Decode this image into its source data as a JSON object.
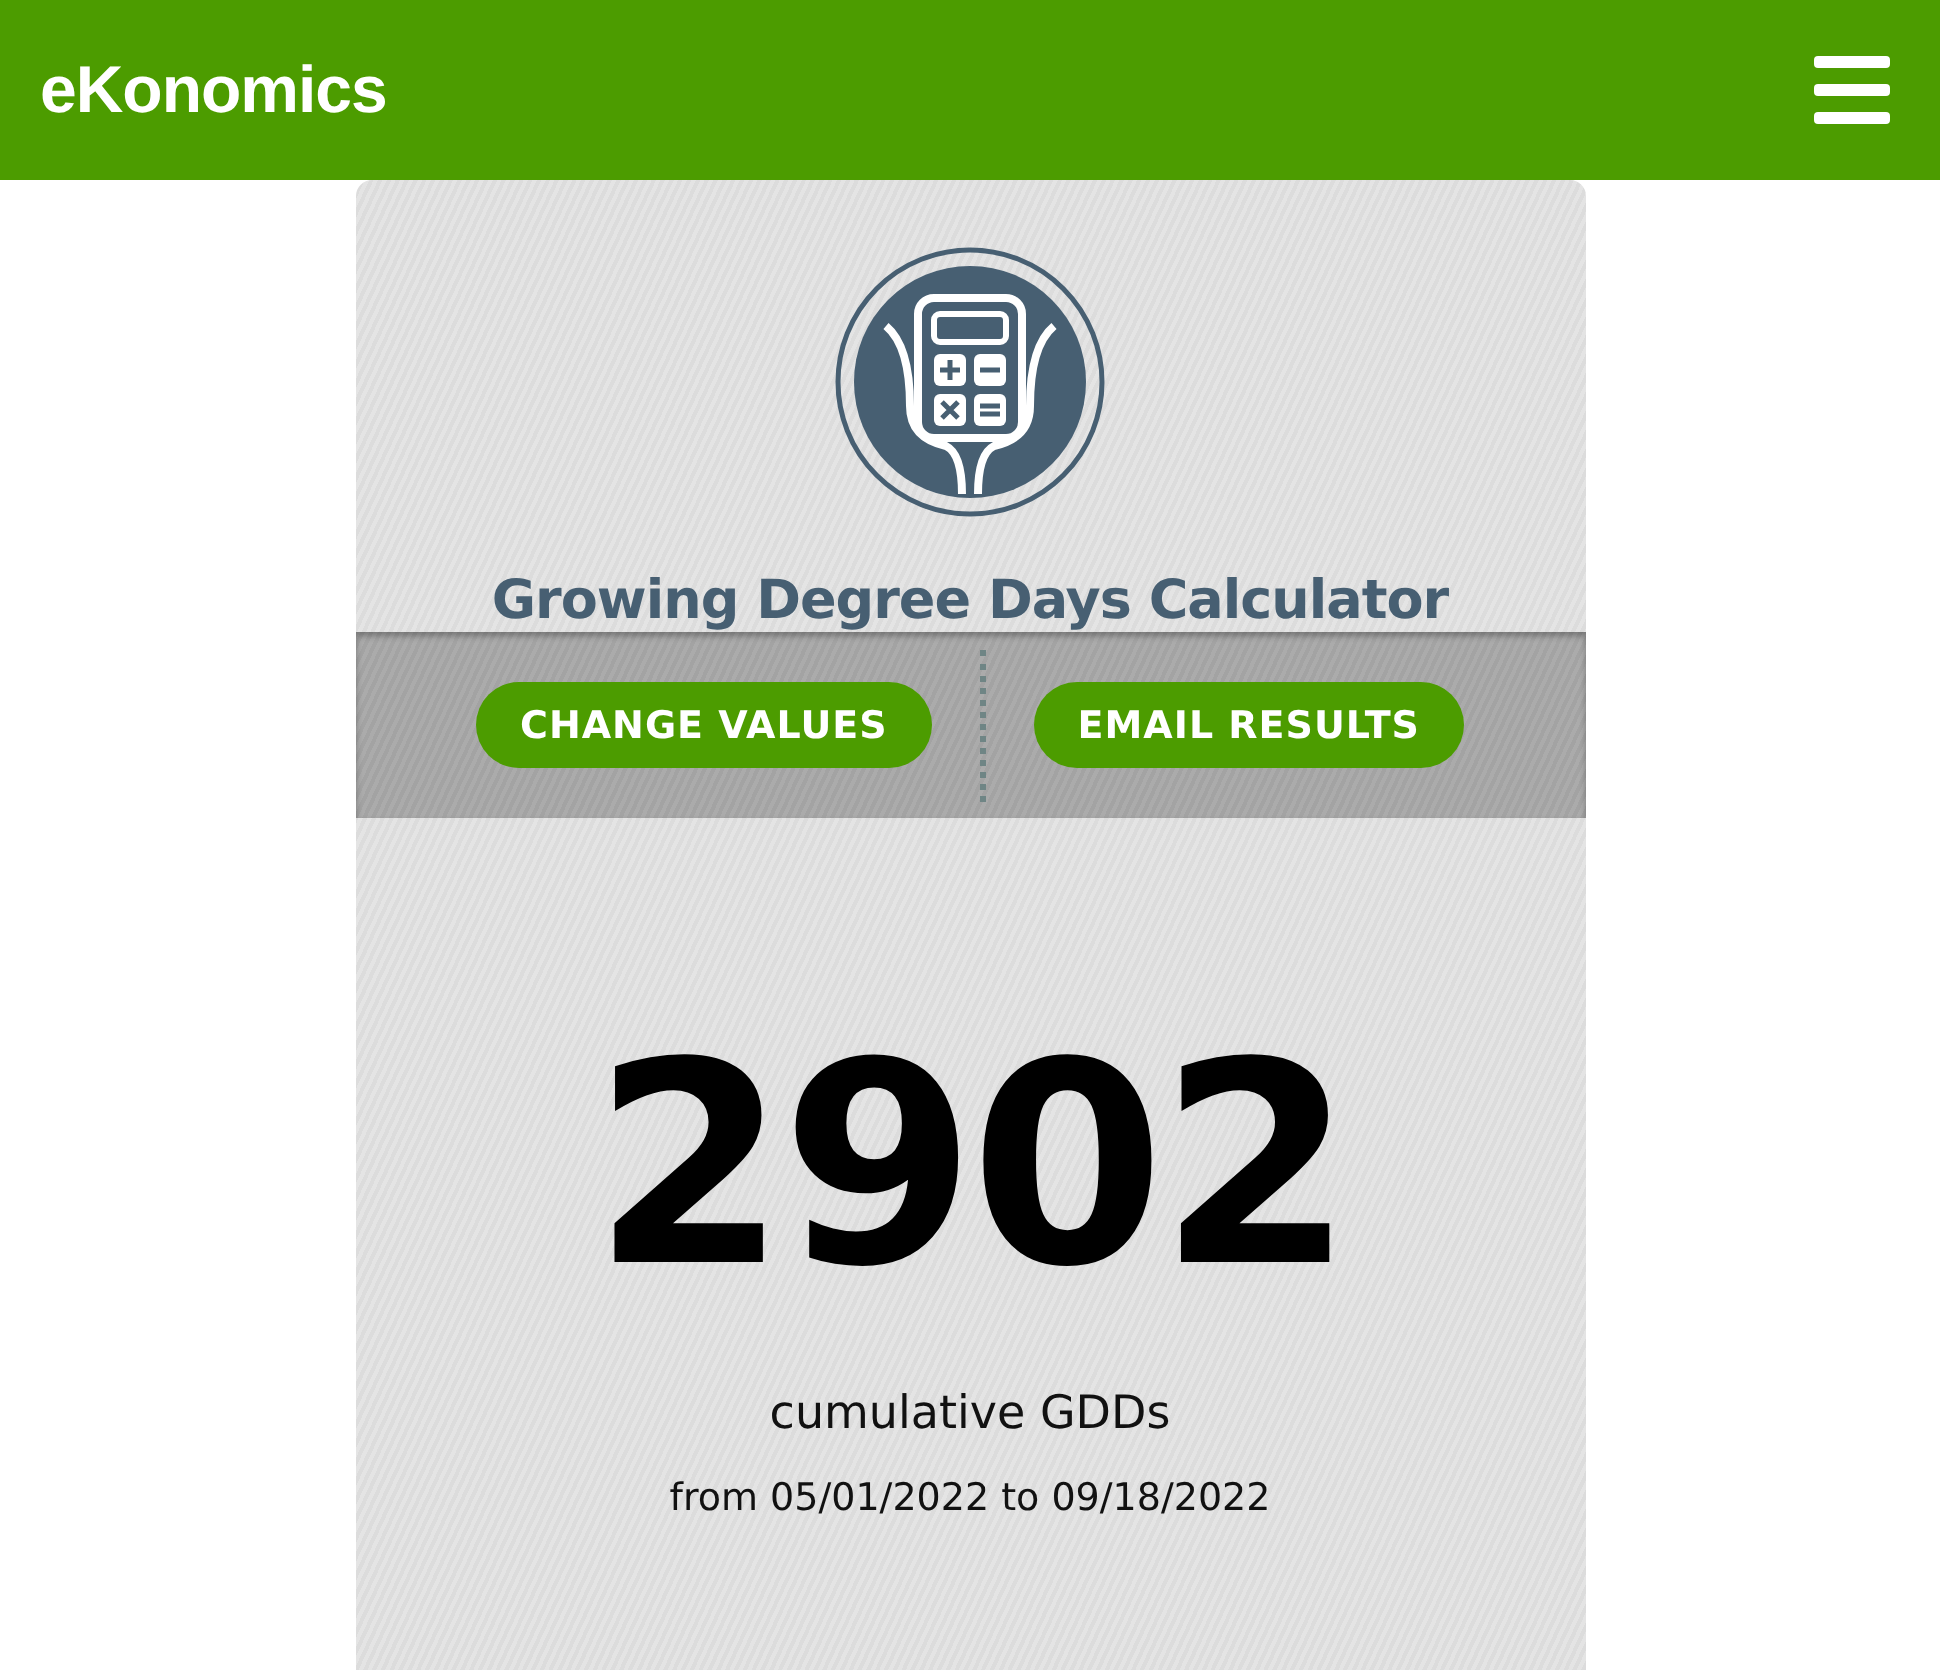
{
  "header": {
    "logo": "eKonomics"
  },
  "calculator": {
    "title": "Growing Degree Days Calculator",
    "actions": [
      "CHANGE VALUES",
      "EMAIL RESULTS"
    ],
    "result": {
      "value": "2902",
      "unit": "cumulative GDDs",
      "range": "from 05/01/2022 to 09/18/2022"
    }
  }
}
